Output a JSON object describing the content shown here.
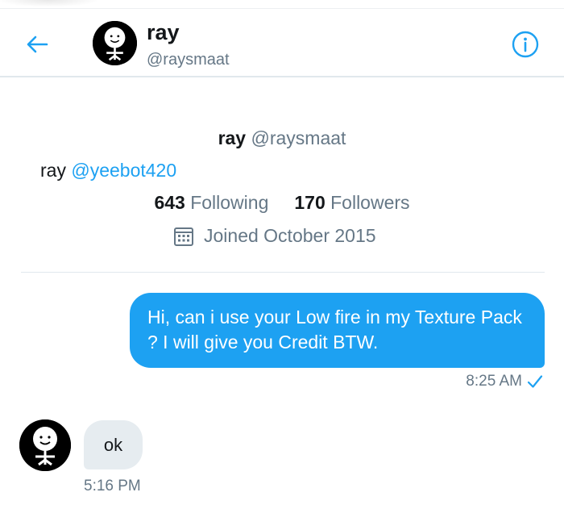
{
  "header": {
    "name": "ray",
    "handle": "@raysmaat"
  },
  "profile": {
    "name": "ray",
    "handle": "@raysmaat",
    "bio_text": "ray ",
    "bio_mention": "@yeebot420",
    "following_count": "643",
    "following_label": "Following",
    "followers_count": "170",
    "followers_label": "Followers",
    "joined": "Joined October 2015"
  },
  "messages": [
    {
      "direction": "sent",
      "text": "Hi, can i use your Low fire in my Texture Pack ? I will give you Credit BTW.",
      "time": "8:25 AM",
      "status_icon": "checkmark"
    },
    {
      "direction": "received",
      "text": "ok",
      "time": "5:16 PM"
    }
  ],
  "colors": {
    "accent": "#1da1f2",
    "muted": "#657786",
    "received_bubble": "#e6ecf0"
  },
  "icons": {
    "back": "arrow-left-icon",
    "info": "info-icon",
    "calendar": "calendar-icon",
    "read": "checkmark-icon"
  }
}
